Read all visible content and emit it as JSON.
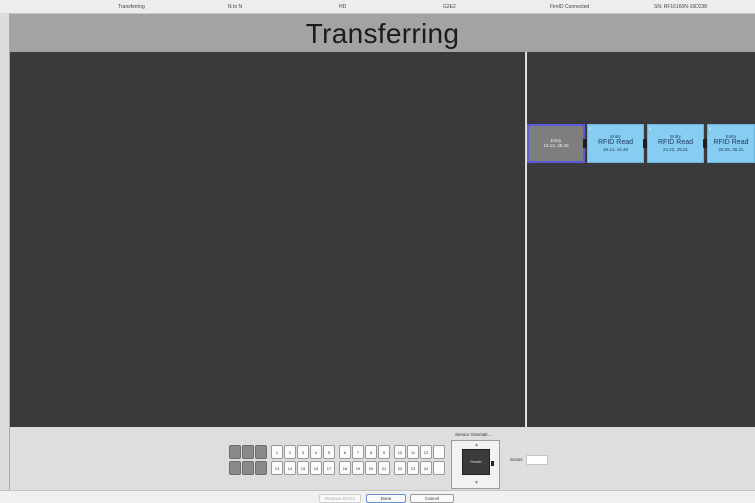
{
  "status_bar": {
    "items": [
      "Transferring",
      "N to N",
      "HD",
      "G2E2",
      "FireID Connected",
      "SN: RF16160N-16D238"
    ]
  },
  "header": {
    "title": "Transferring"
  },
  "track": {
    "cards": [
      {
        "num": "",
        "line1": "Entry",
        "line2": "",
        "line3": "16.14, 36.40",
        "selected": true
      },
      {
        "num": "2",
        "line1": "Entry",
        "line2": "RFID Read",
        "line3": "16.14, 44.46",
        "selected": false
      },
      {
        "num": "3",
        "line1": "Entry",
        "line2": "RFID Read",
        "line3": "24.23, 25.01",
        "selected": false
      },
      {
        "num": "4",
        "line1": "Entry",
        "line2": "RFID Read",
        "line3": "28.25, 36.31",
        "selected": false
      }
    ]
  },
  "keypad": {
    "row1": [
      "",
      "",
      "",
      "1",
      "2",
      "3",
      "4",
      "5",
      "6",
      "7",
      "8",
      "9",
      "10",
      "11",
      "12"
    ],
    "row2": [
      "",
      "",
      "",
      "13",
      "14",
      "15",
      "16",
      "17",
      "18",
      "19",
      "20",
      "21",
      "22",
      "23",
      "24"
    ]
  },
  "sensor": {
    "label": "Sensor Orientati...",
    "inner_label": "Reader",
    "arrow_top": "▲",
    "arrow_bottom": "▼"
  },
  "scans": {
    "label": "Scans",
    "value": ""
  },
  "footer": {
    "buttons": [
      {
        "label": "Remove Errors",
        "enabled": false
      },
      {
        "label": "Done",
        "enabled": true
      },
      {
        "label": "Cancel",
        "enabled": true
      }
    ]
  },
  "colors": {
    "panel_bg": "#3a3a3c",
    "title_bar": "#a3a3a3",
    "card_blue": "#86cdf1",
    "card_selected": "#7e7e7e",
    "selected_border": "#5b5bd8"
  }
}
